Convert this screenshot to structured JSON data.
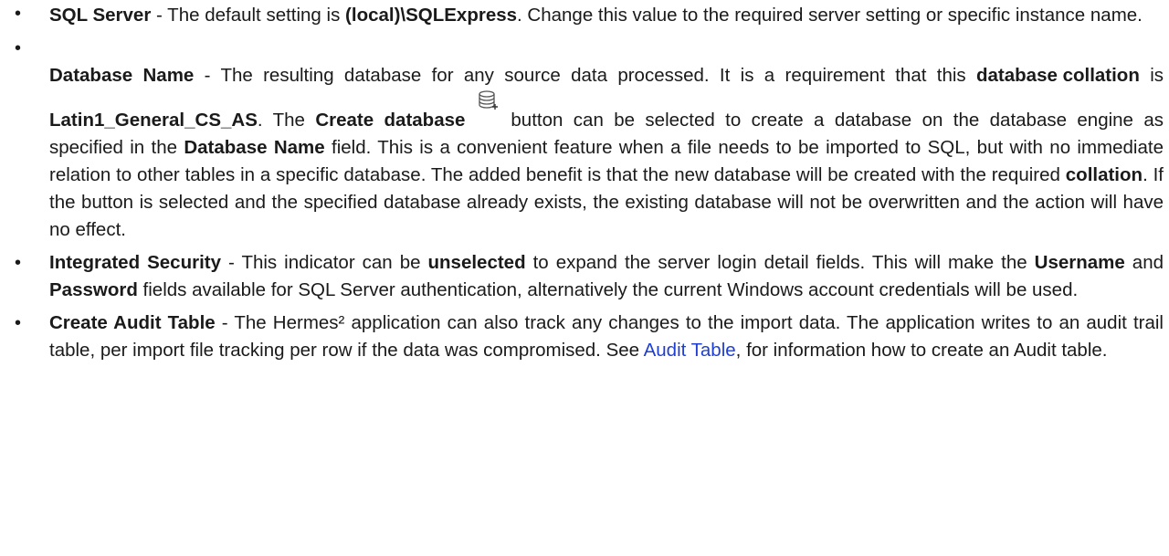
{
  "items": [
    {
      "term": "SQL Server",
      "sep": " - ",
      "t1": "The default setting is ",
      "b1": "(local)\\SQLExpress",
      "t2": ". Change this value to the required server setting or specific instance name."
    },
    {
      "term": "Database Name",
      "sep": " - ",
      "t1": "The resulting database for any source data processed. It is a requirement that this ",
      "b1": "database collation",
      "t2": " is ",
      "b2": "Latin1_General_CS_AS",
      "t3": ". The ",
      "b3": "Create database",
      "icon": "create-database-icon",
      "t4": "button can be selected to create a database on the database engine as specified in the ",
      "b4": "Database Name",
      "t5": " field. This is a convenient feature when a file needs to be imported to SQL, but with no immediate relation to other tables in a specific database. The added benefit is that the new database will be created with the required ",
      "b5": "collation",
      "t6": ". If the button is selected and the specified database already exists, the existing database will not be overwritten and the action will have no effect."
    },
    {
      "term": "Integrated Security",
      "sep": " - ",
      "t1": "This indicator can be ",
      "b1": "unselected",
      "t2": " to expand the server login detail fields. This will make the ",
      "b2": "Username",
      "t3": " and ",
      "b3": "Password",
      "t4": " fields available for SQL Server authentication, alternatively the current Windows account credentials will be used."
    },
    {
      "term": "Create Audit Table",
      "sep": " - ",
      "t1": "The Hermes² application can also track any changes to the import data. The application writes to an audit trail table, per import file tracking per row if the data was compromised. See ",
      "link": "Audit Table",
      "t2": ", for information how to create an Audit table."
    }
  ],
  "bullet": "•",
  "colors": {
    "text": "#1a1a1a",
    "link": "#1f3fd0"
  }
}
